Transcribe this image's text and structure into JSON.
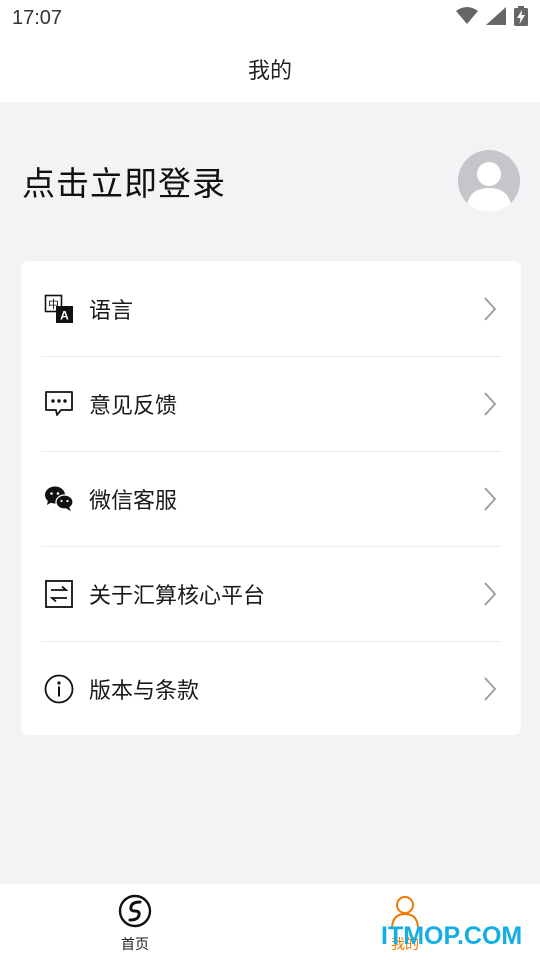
{
  "status_bar": {
    "time": "17:07",
    "icons": [
      "wifi-icon",
      "cell-signal-icon",
      "battery-charging-icon"
    ]
  },
  "header": {
    "title": "我的"
  },
  "profile": {
    "login_prompt": "点击立即登录",
    "avatar_icon": "default-avatar-icon"
  },
  "menu": {
    "items": [
      {
        "label": "语言",
        "icon": "language-icon"
      },
      {
        "label": "意见反馈",
        "icon": "feedback-icon"
      },
      {
        "label": "微信客服",
        "icon": "wechat-icon"
      },
      {
        "label": "关于汇算核心平台",
        "icon": "about-icon"
      },
      {
        "label": "版本与条款",
        "icon": "info-icon"
      }
    ]
  },
  "tab_bar": {
    "tabs": [
      {
        "label": "首页",
        "icon": "home-logo-icon",
        "active": false
      },
      {
        "label": "我的",
        "icon": "person-icon",
        "active": true
      }
    ]
  },
  "watermark": "ITMOP.COM",
  "colors": {
    "accent": "#f07800",
    "background": "#f2f3f5",
    "card": "#ffffff",
    "watermark": "#15aee4"
  }
}
